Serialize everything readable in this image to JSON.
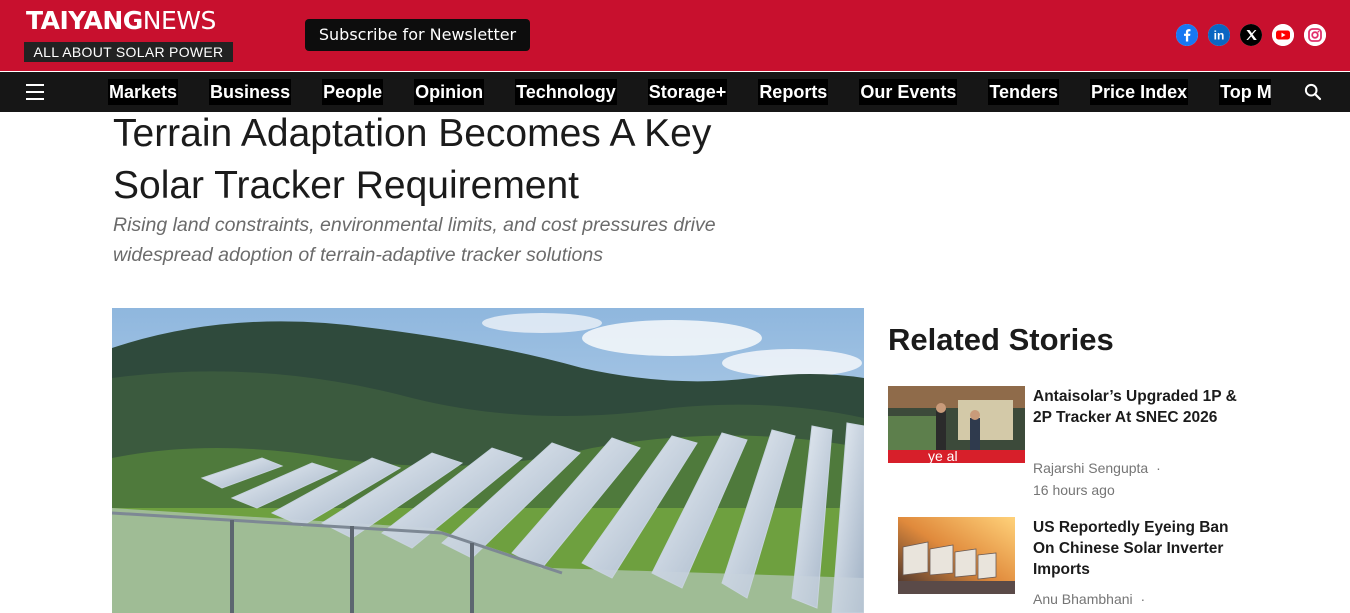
{
  "brand": {
    "name_bold": "TAIYANG",
    "name_light": "NEWS",
    "tagline": "ALL ABOUT SOLAR POWER"
  },
  "header": {
    "subscribe_label": "Subscribe for Newsletter",
    "social": [
      {
        "name": "facebook-icon",
        "color": "#1877f2"
      },
      {
        "name": "linkedin-icon",
        "color": "#0a66c2"
      },
      {
        "name": "x-icon",
        "color": "#000000"
      },
      {
        "name": "youtube-icon",
        "color": "#ff0000"
      },
      {
        "name": "instagram-icon",
        "color": "#e1306c"
      }
    ]
  },
  "nav": {
    "items": [
      "Markets",
      "Business",
      "People",
      "Opinion",
      "Technology",
      "Storage+",
      "Reports",
      "Our Events",
      "Tenders",
      "Price Index",
      "Top Mod"
    ]
  },
  "article": {
    "headline": "Terrain Adaptation Becomes A Key Solar Tracker Requirement",
    "subheadline": "Rising land constraints, environmental limits, and cost pressures drive widespread adoption of terrain-adaptive tracker solutions"
  },
  "related": {
    "title": "Related Stories",
    "stories": [
      {
        "title": "Antaisolar’s Upgraded 1P & 2P Tracker At SNEC 2026",
        "author": "Rajarshi Sengupta",
        "time": "16 hours ago",
        "separator": "·"
      },
      {
        "title": "US Reportedly Eyeing Ban On Chinese Solar Inverter Imports",
        "author": "Anu Bhambhani",
        "separator": "·"
      }
    ]
  },
  "colors": {
    "brand_red": "#c8102e",
    "nav_bg": "#161616"
  }
}
